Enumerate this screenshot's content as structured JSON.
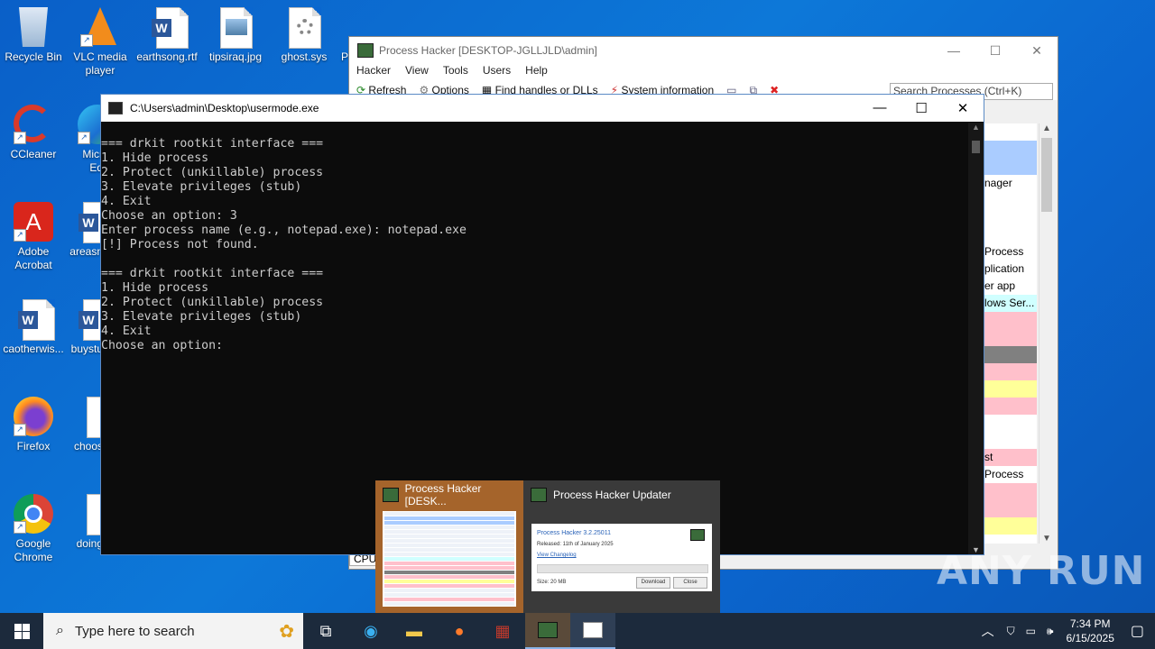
{
  "desktop": {
    "icons": [
      {
        "label": "Recycle Bin"
      },
      {
        "label": "VLC media player"
      },
      {
        "label": "earthsong.rtf"
      },
      {
        "label": "tipsiraq.jpg"
      },
      {
        "label": "ghost.sys"
      },
      {
        "label": "P"
      },
      {
        "label": "CCleaner"
      },
      {
        "label": "Micr Ed"
      },
      {
        "label": "Adobe Acrobat"
      },
      {
        "label": "areasn"
      },
      {
        "label": "caotherwis..."
      },
      {
        "label": "buystu"
      },
      {
        "label": "Firefox"
      },
      {
        "label": "choos"
      },
      {
        "label": "Google Chrome"
      },
      {
        "label": "doing"
      }
    ]
  },
  "process_hacker": {
    "title": "Process Hacker [DESKTOP-JGLLJLD\\admin]",
    "menu": [
      "Hacker",
      "View",
      "Tools",
      "Users",
      "Help"
    ],
    "toolbar": [
      "Refresh",
      "Options",
      "Find handles or DLLs",
      "System information"
    ],
    "search_placeholder": "Search Processes (Ctrl+K)",
    "rows": [
      "",
      "",
      "",
      "nager",
      "",
      "",
      "",
      "Process",
      "plication",
      "er app",
      "lows Ser...",
      "",
      "",
      "",
      "",
      "",
      "",
      "",
      "",
      "st",
      "Process",
      "",
      "",
      ""
    ],
    "row_colors": [
      "#ffffff",
      "#aaccff",
      "#aaccff",
      "#ffffff",
      "#ffffff",
      "#ffffff",
      "#ffffff",
      "#ffffff",
      "#ffffff",
      "#ffffff",
      "#d0ffff",
      "#ffc0cb",
      "#ffc0cb",
      "#808080",
      "#ffc0cb",
      "#ffff99",
      "#ffc0cb",
      "#ffffff",
      "#ffffff",
      "#ffc0cb",
      "#ffffff",
      "#ffc0cb",
      "#ffc0cb",
      "#ffff99"
    ],
    "cpu_label": "CPU"
  },
  "console": {
    "title": "C:\\Users\\admin\\Desktop\\usermode.exe",
    "lines": [
      "",
      "=== drkit rootkit interface ===",
      "1. Hide process",
      "2. Protect (unkillable) process",
      "3. Elevate privileges (stub)",
      "4. Exit",
      "Choose an option: 3",
      "Enter process name (e.g., notepad.exe): notepad.exe",
      "[!] Process not found.",
      "",
      "=== drkit rootkit interface ===",
      "1. Hide process",
      "2. Protect (unkillable) process",
      "3. Elevate privileges (stub)",
      "4. Exit",
      "Choose an option:"
    ]
  },
  "thumbnails": [
    {
      "title": "Process Hacker [DESK..."
    },
    {
      "title": "Process Hacker Updater",
      "preview": {
        "heading": "Process Hacker 3.2.25011",
        "released": "Released: 11th of January 2025",
        "link": "View Changelog",
        "size": "Size: 20 MB",
        "download": "Download",
        "close": "Close"
      }
    }
  ],
  "taskbar": {
    "search_placeholder": "Type here to search",
    "time": "7:34 PM",
    "date": "6/15/2025"
  },
  "watermark": "ANY RUN"
}
